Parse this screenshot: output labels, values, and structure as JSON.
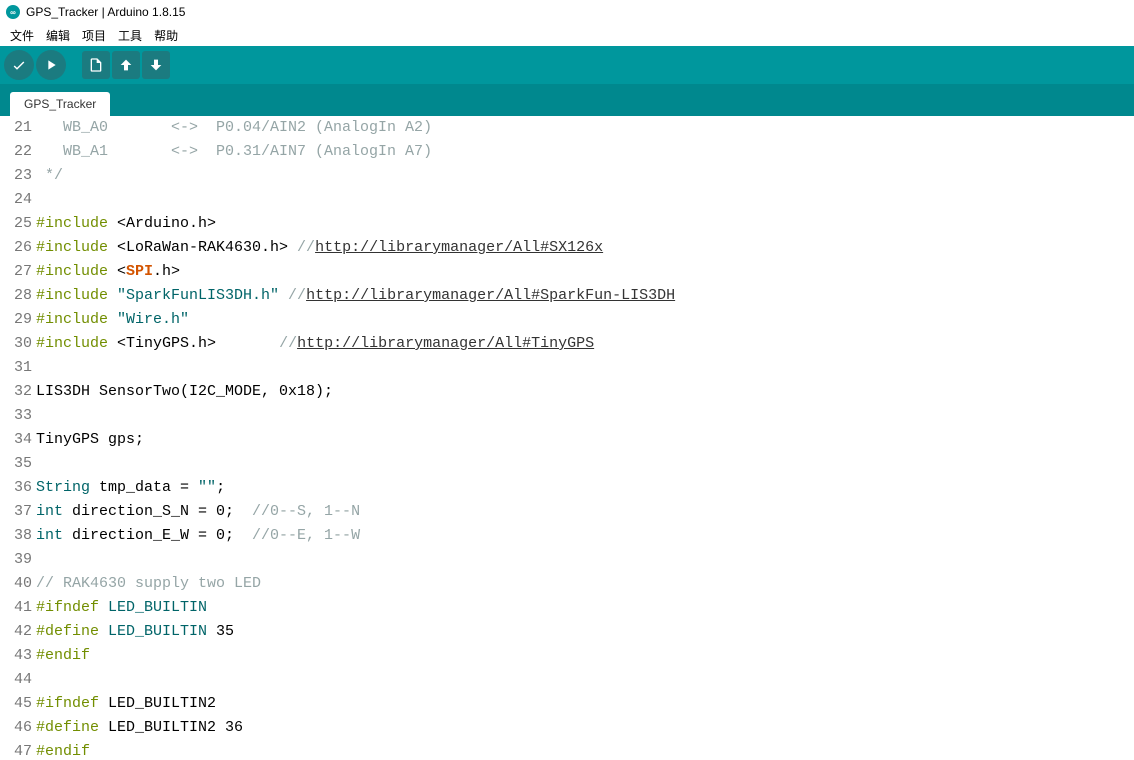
{
  "titlebar": {
    "title": "GPS_Tracker | Arduino 1.8.15"
  },
  "menu": {
    "file": "文件",
    "edit": "编辑",
    "project": "项目",
    "tools": "工具",
    "help": "帮助"
  },
  "tab": {
    "name": "GPS_Tracker"
  },
  "lines": {
    "21": {
      "num": "21",
      "comment": "   WB_A0       <->  P0.04/AIN2 (AnalogIn A2)"
    },
    "22": {
      "num": "22",
      "comment": "   WB_A1       <->  P0.31/AIN7 (AnalogIn A7)"
    },
    "23": {
      "num": "23",
      "comment": " */"
    },
    "24": {
      "num": "24",
      "code": ""
    },
    "25": {
      "num": "25",
      "inc": "#include ",
      "ang1": "<Arduino.h>"
    },
    "26": {
      "num": "26",
      "inc": "#include ",
      "ang1": "<LoRaWan-RAK4630.h>",
      "cmt": " //",
      "link": "http://librarymanager/All#SX126x"
    },
    "27": {
      "num": "27",
      "inc": "#include ",
      "ang1a": "<",
      "spi": "SPI",
      "ang1b": ".h>"
    },
    "28": {
      "num": "28",
      "inc": "#include ",
      "str": "\"SparkFunLIS3DH.h\"",
      "cmt": " //",
      "link": "http://librarymanager/All#SparkFun-LIS3DH"
    },
    "29": {
      "num": "29",
      "inc": "#include ",
      "str": "\"Wire.h\""
    },
    "30": {
      "num": "30",
      "inc": "#include ",
      "ang1": "<TinyGPS.h>",
      "pad": "       ",
      "cmt": "//",
      "link": "http://librarymanager/All#TinyGPS"
    },
    "31": {
      "num": "31",
      "code": ""
    },
    "32": {
      "num": "32",
      "code": "LIS3DH SensorTwo(I2C_MODE, 0x18);"
    },
    "33": {
      "num": "33",
      "code": ""
    },
    "34": {
      "num": "34",
      "code": "TinyGPS gps;"
    },
    "35": {
      "num": "35",
      "code": ""
    },
    "36": {
      "num": "36",
      "type": "String",
      "rest": " tmp_data = ",
      "str": "\"\"",
      "end": ";"
    },
    "37": {
      "num": "37",
      "type": "int",
      "rest": " direction_S_N = 0;  ",
      "cmt": "//0--S, 1--N"
    },
    "38": {
      "num": "38",
      "type": "int",
      "rest": " direction_E_W = 0;  ",
      "cmt": "//0--E, 1--W"
    },
    "39": {
      "num": "39",
      "code": ""
    },
    "40": {
      "num": "40",
      "cmt": "// RAK4630 supply two LED"
    },
    "41": {
      "num": "41",
      "inc": "#ifndef ",
      "const": "LED_BUILTIN"
    },
    "42": {
      "num": "42",
      "inc": "#define ",
      "const": "LED_BUILTIN",
      "rest": " 35"
    },
    "43": {
      "num": "43",
      "inc": "#endif"
    },
    "44": {
      "num": "44",
      "code": ""
    },
    "45": {
      "num": "45",
      "inc": "#ifndef",
      "rest": " LED_BUILTIN2"
    },
    "46": {
      "num": "46",
      "inc": "#define",
      "rest": " LED_BUILTIN2 36"
    },
    "47": {
      "num": "47",
      "inc": "#endif"
    }
  }
}
